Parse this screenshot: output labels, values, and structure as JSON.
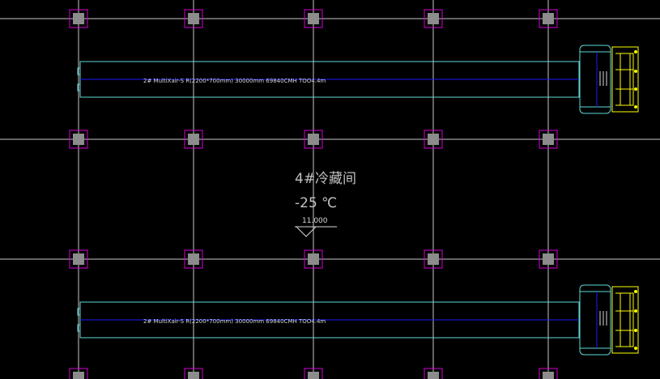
{
  "drawing": {
    "background": "#000000",
    "colors": {
      "grid": "#c8c8c8",
      "column_frame": "#d400d4",
      "column_fill": "#8c8c8c",
      "duct": "#5fd7d7",
      "centerline": "#1a1aff",
      "unit_detail": "#ffff00",
      "text": "#d8d8d8",
      "room_text": "#c0c0c0"
    },
    "ducts": [
      {
        "label": "2# MultiXair-S   R(2200*700mm) 30000mm 69840CMH TOO4.4m"
      },
      {
        "label": "2# MultiXair-S   R(2200*700mm) 30000mm 69840CMH TOO4.4m"
      }
    ],
    "room": {
      "name": "4#冷藏间",
      "temperature": "-25 ℃",
      "elevation": "11.000"
    }
  }
}
